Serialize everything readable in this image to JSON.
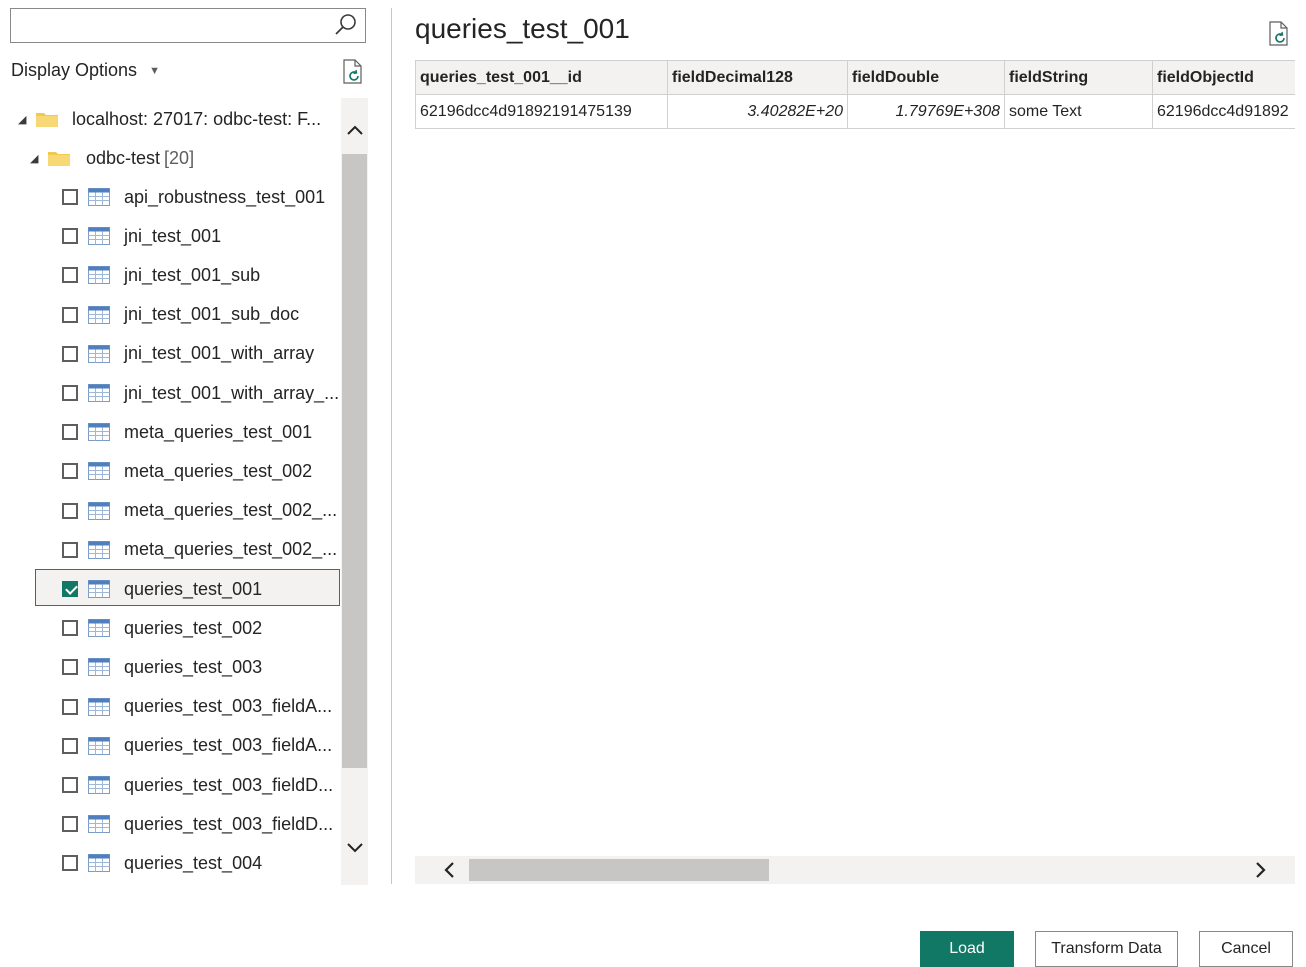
{
  "search": {
    "value": "",
    "placeholder": ""
  },
  "display_options": {
    "label": "Display Options"
  },
  "tree": {
    "server": {
      "label": "localhost: 27017: odbc-test: F..."
    },
    "database": {
      "label": "odbc-test",
      "count": "[20]"
    },
    "items": [
      {
        "label": "api_robustness_test_001",
        "checked": false
      },
      {
        "label": "jni_test_001",
        "checked": false
      },
      {
        "label": "jni_test_001_sub",
        "checked": false
      },
      {
        "label": "jni_test_001_sub_doc",
        "checked": false
      },
      {
        "label": "jni_test_001_with_array",
        "checked": false
      },
      {
        "label": "jni_test_001_with_array_...",
        "checked": false
      },
      {
        "label": "meta_queries_test_001",
        "checked": false
      },
      {
        "label": "meta_queries_test_002",
        "checked": false
      },
      {
        "label": "meta_queries_test_002_...",
        "checked": false
      },
      {
        "label": "meta_queries_test_002_...",
        "checked": false
      },
      {
        "label": "queries_test_001",
        "checked": true
      },
      {
        "label": "queries_test_002",
        "checked": false
      },
      {
        "label": "queries_test_003",
        "checked": false
      },
      {
        "label": "queries_test_003_fieldA...",
        "checked": false
      },
      {
        "label": "queries_test_003_fieldA...",
        "checked": false
      },
      {
        "label": "queries_test_003_fieldD...",
        "checked": false
      },
      {
        "label": "queries_test_003_fieldD...",
        "checked": false
      },
      {
        "label": "queries_test_004",
        "checked": false
      }
    ]
  },
  "preview": {
    "title": "queries_test_001",
    "columns": [
      "queries_test_001__id",
      "fieldDecimal128",
      "fieldDouble",
      "fieldString",
      "fieldObjectId"
    ],
    "rows": [
      [
        "62196dcc4d91892191475139",
        "3.40282E+20",
        "1.79769E+308",
        "some Text",
        "62196dcc4d91892"
      ]
    ]
  },
  "buttons": {
    "load": "Load",
    "transform": "Transform Data",
    "cancel": "Cancel"
  },
  "colors": {
    "accent": "#117865",
    "border": "#8a8886",
    "scroll_track": "#f3f2f1",
    "scroll_thumb": "#c8c6c4"
  }
}
